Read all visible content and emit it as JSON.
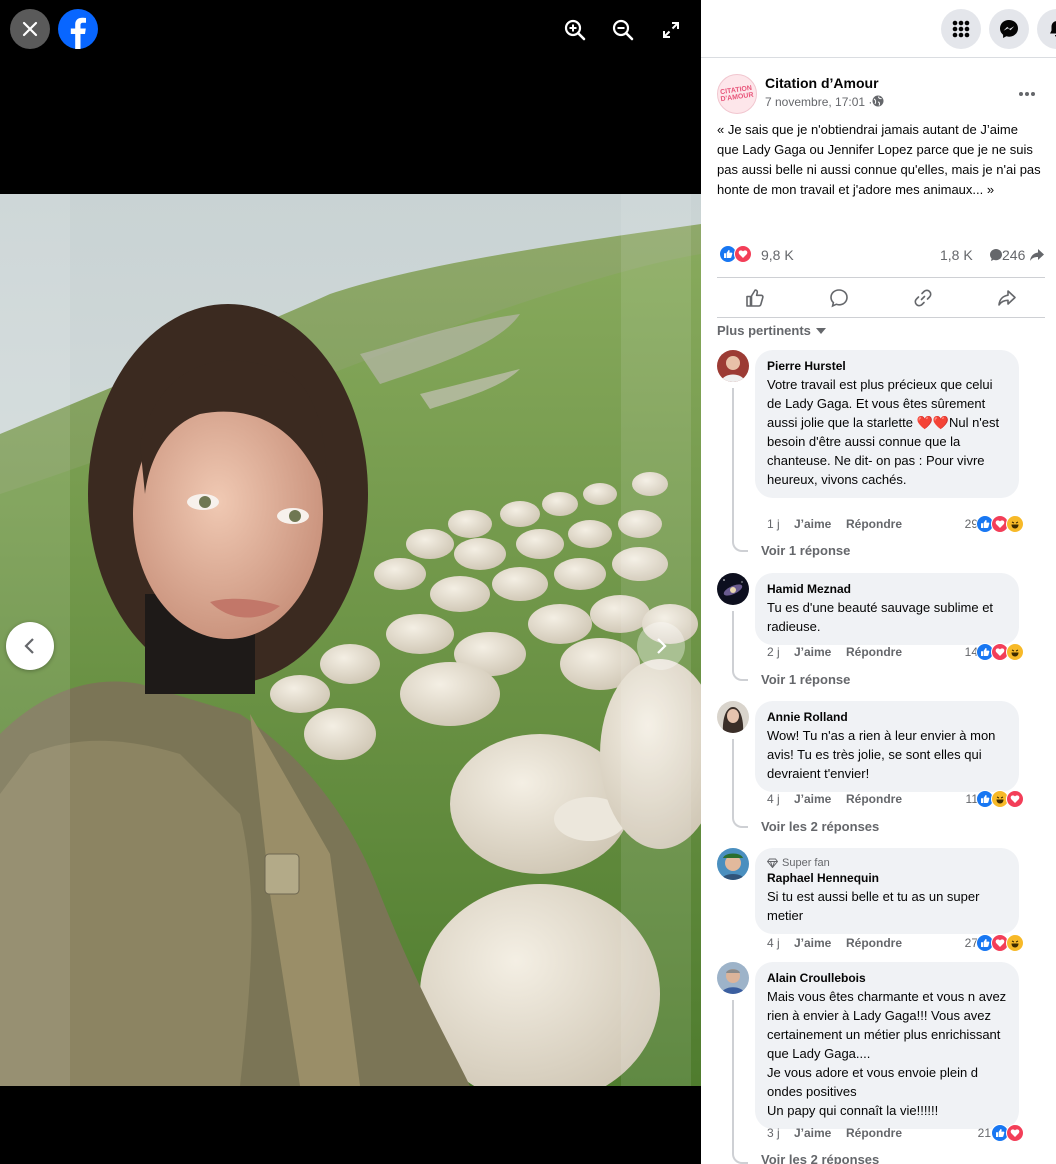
{
  "viewer": {
    "close_icon": "close-icon",
    "logo": "facebook-logo",
    "tools": [
      "zoom-in-icon",
      "zoom-out-icon",
      "fullscreen-icon"
    ],
    "prev_icon": "chevron-left-icon",
    "next_icon": "chevron-right-icon"
  },
  "topbar": {
    "icons": [
      "menu-grid-icon",
      "messenger-icon",
      "notifications-icon"
    ]
  },
  "post": {
    "page_name": "Citation d’Amour",
    "date": "7 novembre, 17:01 ·",
    "avatar_logo": "CITATION D'AMOUR",
    "text": "« Je sais que je n'obtiendrai jamais autant de J’aime que Lady Gaga ou Jennifer Lopez parce que je ne suis pas aussi belle ni aussi connue qu'elles, mais je n'ai pas honte de mon travail et j'adore mes animaux... »",
    "reaction_count": "9,8 K",
    "comment_count": "1,8 K",
    "share_count": "246",
    "sort_label": "Plus pertinents",
    "colors": {
      "like": "#1877f2",
      "love": "#f33e58",
      "haha": "#f7b928",
      "brand": "#0866ff"
    }
  },
  "comments": [
    {
      "name": "Pierre Hurstel",
      "text": "Votre travail est plus précieux que celui de Lady Gaga. Et vous êtes sûrement aussi jolie que la starlette ❤️❤️Nul n'est besoin d'être aussi connue que la chanteuse. Ne dit- on pas : Pour vivre heureux, vivons cachés.",
      "time": "1 j",
      "like_label": "J’aime",
      "reply_label": "Répondre",
      "count": "29",
      "replies": "Voir 1 réponse"
    },
    {
      "name": "Hamid Meznad",
      "text": "Tu es d'une beauté sauvage sublime et radieuse.",
      "time": "2 j",
      "like_label": "J’aime",
      "reply_label": "Répondre",
      "count": "14",
      "replies": "Voir 1 réponse"
    },
    {
      "name": "Annie Rolland",
      "text": "Wow! Tu n'as a rien à leur envier à mon avis! Tu es très jolie, se sont elles qui devraient t'envier!",
      "time": "4 j",
      "like_label": "J’aime",
      "reply_label": "Répondre",
      "count": "11",
      "replies": "Voir les 2 réponses"
    },
    {
      "name": "Raphael Hennequin",
      "badge": "Super fan",
      "text": "Si tu est aussi belle et tu as un super metier",
      "time": "4 j",
      "like_label": "J’aime",
      "reply_label": "Répondre",
      "count": "27"
    },
    {
      "name": "Alain Croullebois",
      "text": "Mais vous êtes charmante et vous n avez rien à envier à Lady Gaga!!! Vous avez certainement un métier plus enrichissant que Lady Gaga....\nJe vous adore et vous envoie plein d ondes positives\nUn papy qui connaît la vie!!!!!!",
      "time": "3 j",
      "like_label": "J’aime",
      "reply_label": "Répondre",
      "count": "21",
      "replies": "Voir les 2 réponses"
    }
  ]
}
